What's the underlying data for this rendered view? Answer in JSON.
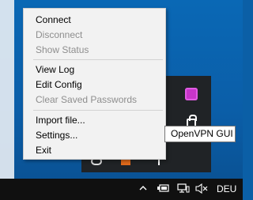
{
  "context_menu": {
    "items": [
      {
        "label": "Connect",
        "enabled": true
      },
      {
        "label": "Disconnect",
        "enabled": false
      },
      {
        "label": "Show Status",
        "enabled": false
      },
      {
        "label": "View Log",
        "enabled": true
      },
      {
        "label": "Edit Config",
        "enabled": true
      },
      {
        "label": "Clear Saved Passwords",
        "enabled": false
      },
      {
        "label": "Import file...",
        "enabled": true
      },
      {
        "label": "Settings...",
        "enabled": true
      },
      {
        "label": "Exit",
        "enabled": true
      }
    ]
  },
  "tooltip": {
    "text": "OpenVPN GUI"
  },
  "taskbar": {
    "language": "DEU",
    "icons": [
      "chevron-up-icon",
      "battery-icon",
      "network-icon",
      "volume-muted-icon"
    ]
  },
  "tray_overflow": {
    "icons": [
      "openvpn-icon",
      "lock-icon",
      "chat-icon",
      "orange-app-icon",
      "pin-icon"
    ]
  },
  "colors": {
    "desktop": "#0b5fa6",
    "menu_background": "#f2f2f2",
    "disabled_text": "#8e8e8e",
    "taskbar": "#101010",
    "openvpn_icon": "#c735c9"
  }
}
